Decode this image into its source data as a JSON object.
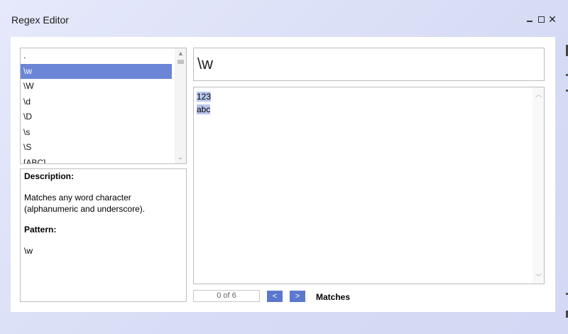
{
  "window": {
    "title": "Regex Editor",
    "controls": {
      "minimize": "minimize-icon",
      "maximize": "maximize-icon",
      "close": "close-icon"
    }
  },
  "patterns": {
    "items": [
      ".",
      "\\w",
      "\\W",
      "\\d",
      "\\D",
      "\\s",
      "\\S",
      "[ABC]"
    ],
    "selected_index": 1
  },
  "description": {
    "heading": "Description:",
    "text": "Matches any word character (alphanumeric and underscore).",
    "pattern_heading": "Pattern:",
    "pattern_value": "\\w"
  },
  "editor": {
    "pattern": "\\w",
    "test_lines": [
      "123",
      "abc"
    ]
  },
  "navigation": {
    "counter": "0 of 6",
    "prev_label": "<",
    "next_label": ">",
    "matches_label": "Matches"
  },
  "colors": {
    "selected": "#6b86d6",
    "highlight": "#b9c6ee",
    "button": "#5b78cf"
  }
}
